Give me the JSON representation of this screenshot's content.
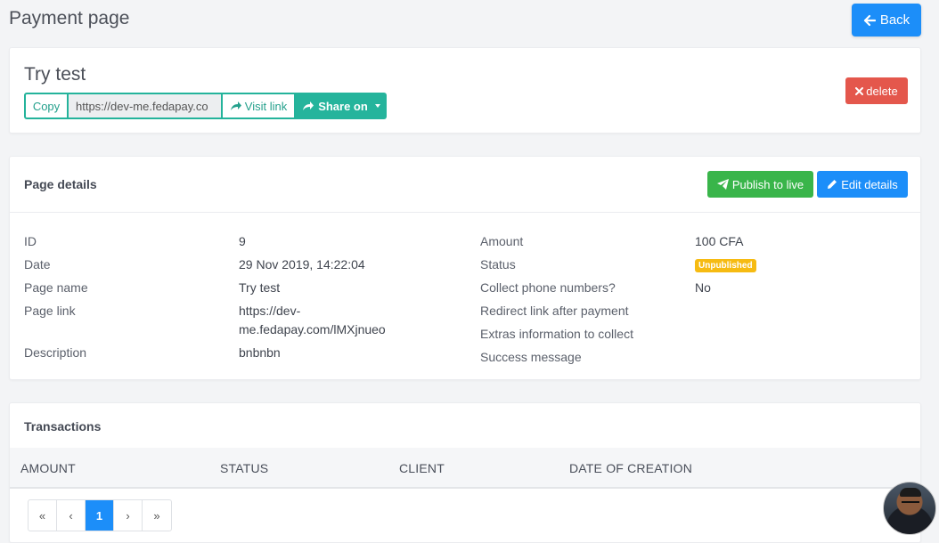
{
  "header": {
    "title": "Payment page",
    "back_label": "Back"
  },
  "page_card": {
    "title": "Try test",
    "copy_label": "Copy",
    "url_value": "https://dev-me.fedapay.co",
    "visit_label": "Visit link",
    "share_label": "Share on",
    "delete_label": "delete"
  },
  "details": {
    "heading": "Page details",
    "publish_label": "Publish to live",
    "edit_label": "Edit details",
    "left": {
      "id_label": "ID",
      "id_value": "9",
      "date_label": "Date",
      "date_value": "29 Nov 2019, 14:22:04",
      "name_label": "Page name",
      "name_value": "Try test",
      "link_label": "Page link",
      "link_value_line1": "https://dev-",
      "link_value_line2": "me.fedapay.com/lMXjnueo",
      "desc_label": "Description",
      "desc_value": "bnbnbn"
    },
    "right": {
      "amount_label": "Amount",
      "amount_value": "100 CFA",
      "status_label": "Status",
      "status_value": "Unpublished",
      "phone_label": "Collect phone numbers?",
      "phone_value": "No",
      "redirect_label": "Redirect link after payment",
      "extras_label": "Extras information to collect",
      "success_label": "Success message"
    }
  },
  "transactions": {
    "heading": "Transactions",
    "columns": [
      "AMOUNT",
      "STATUS",
      "CLIENT",
      "DATE OF CREATION"
    ],
    "pager": {
      "first": "«",
      "prev": "‹",
      "current": "1",
      "next": "›",
      "last": "»"
    }
  },
  "colors": {
    "primary": "#1c8ef9",
    "teal": "#25b49c",
    "danger": "#e4574c",
    "success": "#39b54a",
    "warning": "#f6bb12"
  }
}
